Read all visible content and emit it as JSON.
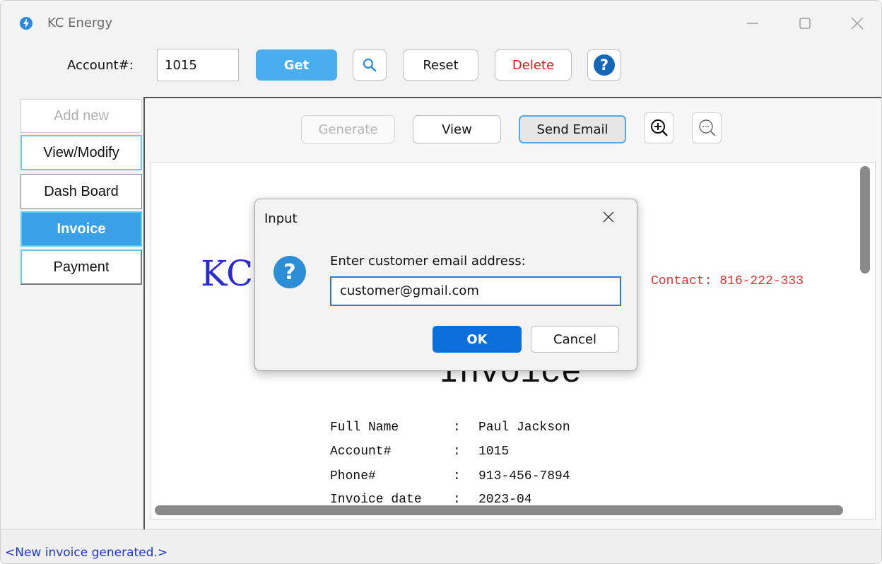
{
  "window": {
    "title": "KC Energy",
    "app_icon": "lightning-icon",
    "controls": [
      "minimize-icon",
      "maximize-icon",
      "close-icon"
    ]
  },
  "toolbar": {
    "account_label": "Account#:",
    "account_value": "1015",
    "get_label": "Get",
    "search_icon": "search-icon",
    "reset_label": "Reset",
    "delete_label": "Delete",
    "help_icon": "help-icon"
  },
  "nav": {
    "items": [
      {
        "label": "Add new",
        "state": "disabled"
      },
      {
        "label": "View/Modify",
        "state": "normal"
      },
      {
        "label": "Dash Board",
        "state": "normal"
      },
      {
        "label": "Invoice",
        "state": "active"
      },
      {
        "label": "Payment",
        "state": "normal"
      }
    ]
  },
  "invoice_toolbar": {
    "generate_label": "Generate",
    "view_label": "View",
    "send_email_label": "Send Email",
    "zoom_in_icon": "zoom-in-icon",
    "zoom_out_icon": "zoom-out-icon"
  },
  "document": {
    "company_partial": "KC",
    "contact": "Contact: 816-222-333",
    "heading": "Invoice",
    "fields": [
      {
        "label": "Full Name",
        "value": "Paul Jackson"
      },
      {
        "label": "Account#",
        "value": "1015"
      },
      {
        "label": "Phone#",
        "value": "913-456-7894"
      },
      {
        "label": "Invoice date",
        "value": "2023-04"
      }
    ]
  },
  "dialog": {
    "title": "Input",
    "icon": "question-icon",
    "prompt": "Enter customer email address:",
    "input_value": "customer@gmail.com",
    "ok_label": "OK",
    "cancel_label": "Cancel"
  },
  "status": {
    "message": "<New invoice generated.>"
  },
  "colors": {
    "accent": "#49aef0",
    "active_nav": "#3aa0e8",
    "delete": "#e01a1a",
    "status_text": "#1a35d9",
    "company_blue": "#2b2bd6",
    "contact_red": "#e83030",
    "ok_button": "#0a6fd9"
  }
}
